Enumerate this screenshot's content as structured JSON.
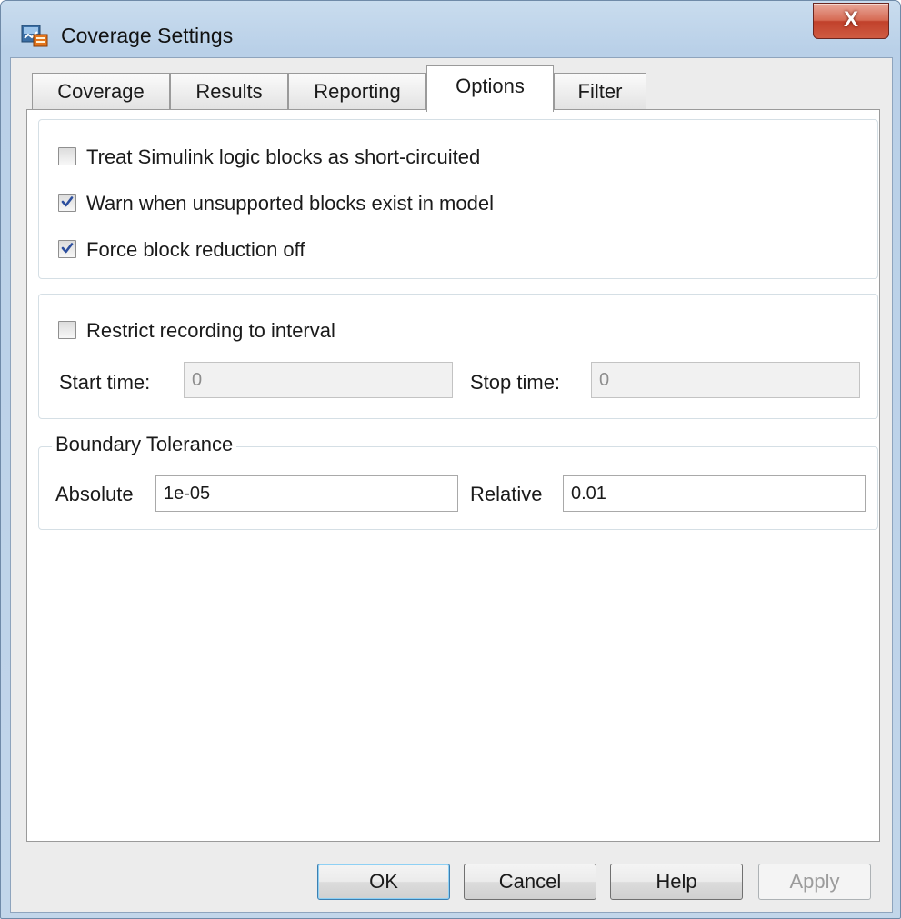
{
  "window": {
    "title": "Coverage Settings",
    "close_label": "X"
  },
  "tabs": [
    {
      "label": "Coverage"
    },
    {
      "label": "Results"
    },
    {
      "label": "Reporting"
    },
    {
      "label": "Options",
      "active": true
    },
    {
      "label": "Filter"
    }
  ],
  "options": {
    "short_circuit": {
      "label": "Treat Simulink logic blocks as short-circuited",
      "checked": false
    },
    "warn_unsupported": {
      "label": "Warn when unsupported blocks exist in model",
      "checked": true
    },
    "force_block_reduction": {
      "label": "Force block reduction off",
      "checked": true
    }
  },
  "interval": {
    "restrict": {
      "label": "Restrict recording to interval",
      "checked": false
    },
    "start_label": "Start time:",
    "start_value": "0",
    "stop_label": "Stop time:",
    "stop_value": "0"
  },
  "tolerance": {
    "title": "Boundary Tolerance",
    "absolute_label": "Absolute",
    "absolute_value": "1e-05",
    "relative_label": "Relative",
    "relative_value": "0.01"
  },
  "buttons": {
    "ok": "OK",
    "cancel": "Cancel",
    "help": "Help",
    "apply": "Apply"
  }
}
